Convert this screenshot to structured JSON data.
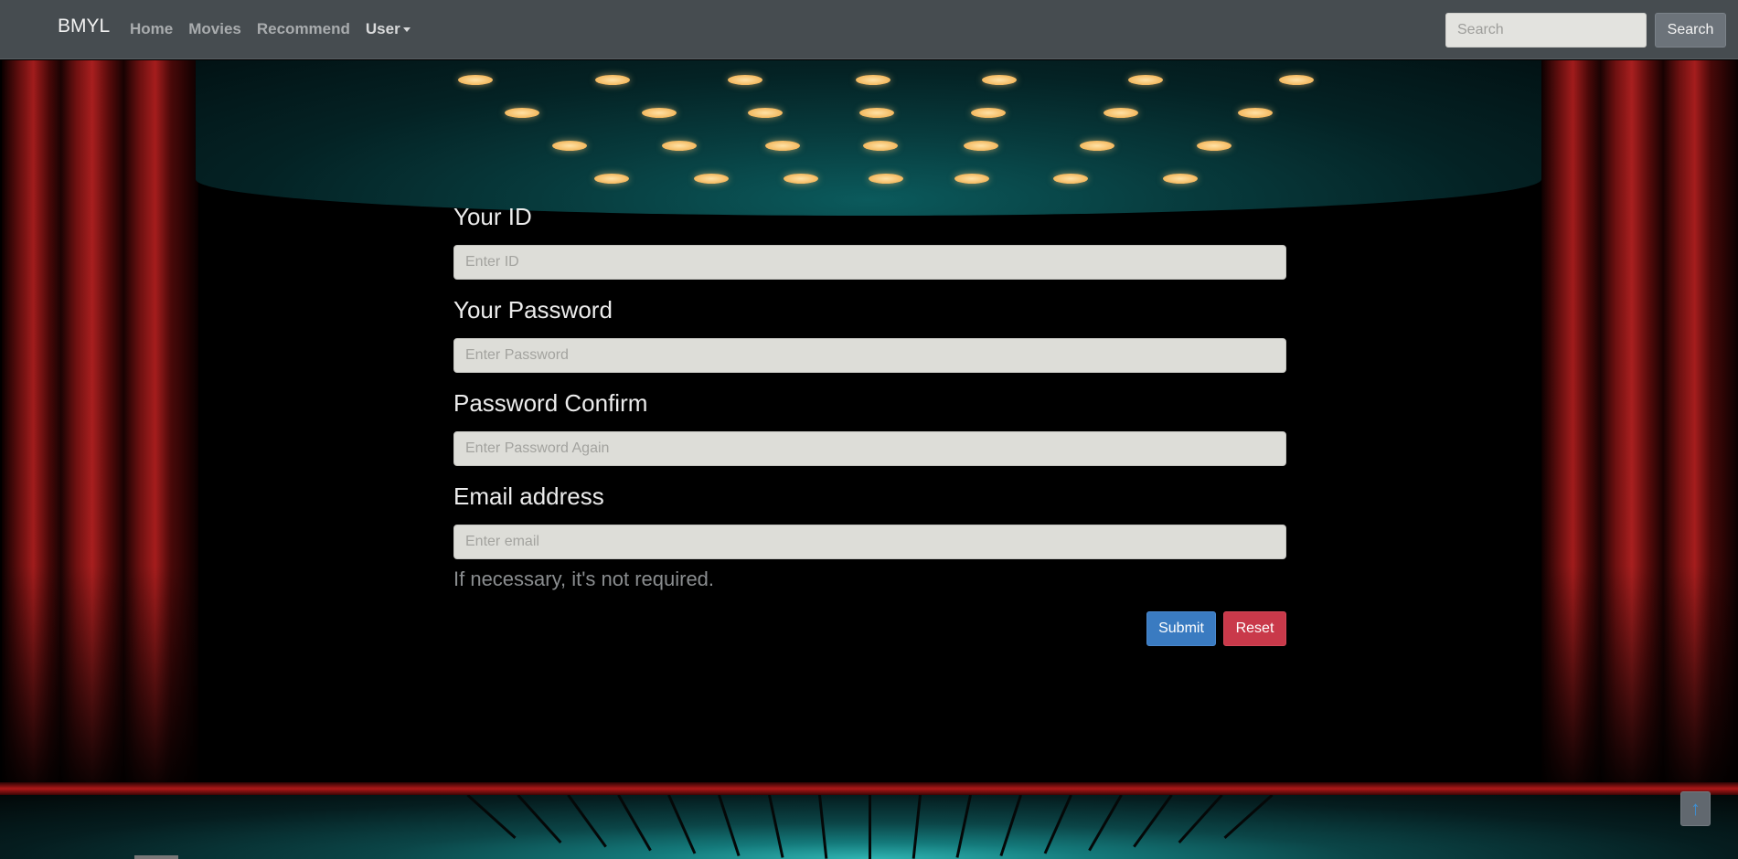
{
  "navbar": {
    "brand": "BMYL",
    "links": [
      {
        "label": "Home"
      },
      {
        "label": "Movies"
      },
      {
        "label": "Recommend"
      },
      {
        "label": "User"
      }
    ],
    "search": {
      "placeholder": "Search",
      "button_label": "Search"
    }
  },
  "form": {
    "id": {
      "label": "Your ID",
      "placeholder": "Enter ID"
    },
    "password": {
      "label": "Your Password",
      "placeholder": "Enter Password"
    },
    "confirm": {
      "label": "Password Confirm",
      "placeholder": "Enter Password Again"
    },
    "email": {
      "label": "Email address",
      "placeholder": "Enter email",
      "help": "If necessary, it's not required."
    },
    "submit_label": "Submit",
    "reset_label": "Reset"
  },
  "icons": {
    "scroll_top": "arrow-up-icon",
    "user_menu": "caret-down-icon"
  },
  "colors": {
    "navbar": "#464c50",
    "submit": "#3a7bc1",
    "reset": "#c9394a",
    "input": "#ddddd8"
  }
}
